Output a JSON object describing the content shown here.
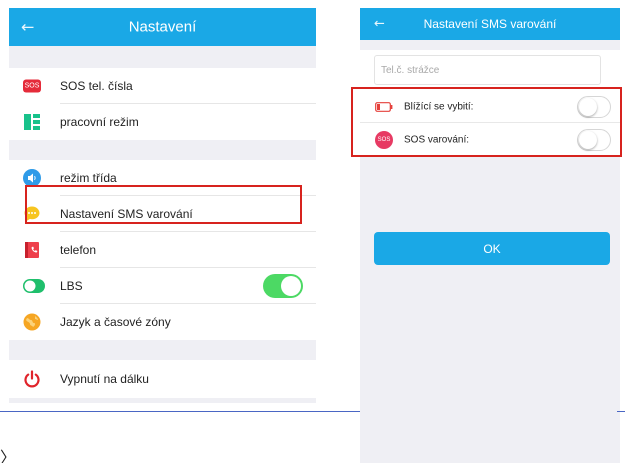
{
  "left": {
    "header": {
      "back_glyph": "←",
      "title": "Nastavení"
    },
    "items": [
      {
        "label": "SOS tel. čísla",
        "icon": "sos-icon",
        "icon_text": "SOS"
      },
      {
        "label": "pracovní režim",
        "icon": "work-mode-icon"
      },
      {
        "label": "režim třída",
        "icon": "speaker-icon"
      },
      {
        "label": "Nastavení SMS varování",
        "icon": "message-icon"
      },
      {
        "label": "telefon",
        "icon": "phone-book-icon"
      },
      {
        "label": "LBS",
        "icon": "lbs-icon",
        "toggle_on": true
      },
      {
        "label": "Jazyk a časové zóny",
        "icon": "globe-icon"
      },
      {
        "label": "Vypnutí  na dálku",
        "icon": "power-icon"
      }
    ]
  },
  "right": {
    "header": {
      "back_glyph": "←",
      "title": "Nastavení SMS varování"
    },
    "guard_input": {
      "placeholder": "Tel.č. strážce",
      "value": ""
    },
    "items": [
      {
        "label": "Blížící se vybití:",
        "icon": "low-battery-icon",
        "toggle_on": false
      },
      {
        "label": "SOS varování:",
        "icon": "sos-icon",
        "icon_text": "SOS",
        "toggle_on": false
      }
    ],
    "ok_label": "OK"
  },
  "stray": {
    "chevron": "〉"
  },
  "colors": {
    "accent": "#1aa8e6",
    "highlight": "#d7231e",
    "toggle_on": "#4cd964",
    "background": "#efeff4"
  }
}
